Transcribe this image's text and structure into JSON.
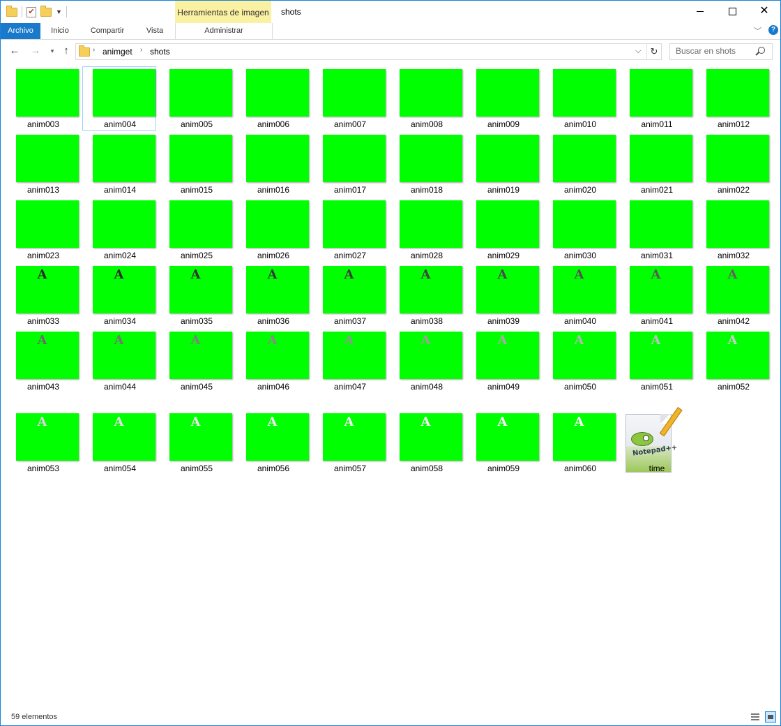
{
  "window": {
    "title": "shots",
    "context_tab_group": "Herramientas de imagen"
  },
  "ribbon": {
    "tabs": [
      "Archivo",
      "Inicio",
      "Compartir",
      "Vista"
    ],
    "context_tab": "Administrar"
  },
  "address": {
    "path": [
      "animget",
      "shots"
    ]
  },
  "search": {
    "placeholder": "Buscar en shots"
  },
  "files": [
    {
      "name": "anim003",
      "type": "image",
      "glyph": ""
    },
    {
      "name": "anim004",
      "type": "image",
      "glyph": "",
      "selected": true
    },
    {
      "name": "anim005",
      "type": "image",
      "glyph": ""
    },
    {
      "name": "anim006",
      "type": "image",
      "glyph": ""
    },
    {
      "name": "anim007",
      "type": "image",
      "glyph": ""
    },
    {
      "name": "anim008",
      "type": "image",
      "glyph": ""
    },
    {
      "name": "anim009",
      "type": "image",
      "glyph": ""
    },
    {
      "name": "anim010",
      "type": "image",
      "glyph": ""
    },
    {
      "name": "anim011",
      "type": "image",
      "glyph": ""
    },
    {
      "name": "anim012",
      "type": "image",
      "glyph": ""
    },
    {
      "name": "anim013",
      "type": "image",
      "glyph": ""
    },
    {
      "name": "anim014",
      "type": "image",
      "glyph": ""
    },
    {
      "name": "anim015",
      "type": "image",
      "glyph": ""
    },
    {
      "name": "anim016",
      "type": "image",
      "glyph": ""
    },
    {
      "name": "anim017",
      "type": "image",
      "glyph": ""
    },
    {
      "name": "anim018",
      "type": "image",
      "glyph": ""
    },
    {
      "name": "anim019",
      "type": "image",
      "glyph": ""
    },
    {
      "name": "anim020",
      "type": "image",
      "glyph": ""
    },
    {
      "name": "anim021",
      "type": "image",
      "glyph": ""
    },
    {
      "name": "anim022",
      "type": "image",
      "glyph": ""
    },
    {
      "name": "anim023",
      "type": "image",
      "glyph": ""
    },
    {
      "name": "anim024",
      "type": "image",
      "glyph": ""
    },
    {
      "name": "anim025",
      "type": "image",
      "glyph": ""
    },
    {
      "name": "anim026",
      "type": "image",
      "glyph": ""
    },
    {
      "name": "anim027",
      "type": "image",
      "glyph": ""
    },
    {
      "name": "anim028",
      "type": "image",
      "glyph": ""
    },
    {
      "name": "anim029",
      "type": "image",
      "glyph": ""
    },
    {
      "name": "anim030",
      "type": "image",
      "glyph": ""
    },
    {
      "name": "anim031",
      "type": "image",
      "glyph": ""
    },
    {
      "name": "anim032",
      "type": "image",
      "glyph": ""
    },
    {
      "name": "anim033",
      "type": "image",
      "glyph": "A",
      "glyph_color": "#2a2a2a"
    },
    {
      "name": "anim034",
      "type": "image",
      "glyph": "A",
      "glyph_color": "#2e2e2e"
    },
    {
      "name": "anim035",
      "type": "image",
      "glyph": "A",
      "glyph_color": "#333333"
    },
    {
      "name": "anim036",
      "type": "image",
      "glyph": "A",
      "glyph_color": "#383838"
    },
    {
      "name": "anim037",
      "type": "image",
      "glyph": "A",
      "glyph_color": "#3d3d3d"
    },
    {
      "name": "anim038",
      "type": "image",
      "glyph": "A",
      "glyph_color": "#424242"
    },
    {
      "name": "anim039",
      "type": "image",
      "glyph": "A",
      "glyph_color": "#4a4a4a"
    },
    {
      "name": "anim040",
      "type": "image",
      "glyph": "A",
      "glyph_color": "#525252"
    },
    {
      "name": "anim041",
      "type": "image",
      "glyph": "A",
      "glyph_color": "#5a5a5a"
    },
    {
      "name": "anim042",
      "type": "image",
      "glyph": "A",
      "glyph_color": "#626262"
    },
    {
      "name": "anim043",
      "type": "image",
      "glyph": "A",
      "glyph_color": "#6b6b6b"
    },
    {
      "name": "anim044",
      "type": "image",
      "glyph": "A",
      "glyph_color": "#757575"
    },
    {
      "name": "anim045",
      "type": "image",
      "glyph": "A",
      "glyph_color": "#7f7f7f"
    },
    {
      "name": "anim046",
      "type": "image",
      "glyph": "A",
      "glyph_color": "#898989"
    },
    {
      "name": "anim047",
      "type": "image",
      "glyph": "A",
      "glyph_color": "#949494"
    },
    {
      "name": "anim048",
      "type": "image",
      "glyph": "A",
      "glyph_color": "#9f9f9f"
    },
    {
      "name": "anim049",
      "type": "image",
      "glyph": "A",
      "glyph_color": "#aaaaaa"
    },
    {
      "name": "anim050",
      "type": "image",
      "glyph": "A",
      "glyph_color": "#b5b5b5"
    },
    {
      "name": "anim051",
      "type": "image",
      "glyph": "A",
      "glyph_color": "#c0c0c0"
    },
    {
      "name": "anim052",
      "type": "image",
      "glyph": "A",
      "glyph_color": "#cbcbcb"
    },
    {
      "name": "anim053",
      "type": "image",
      "glyph": "A",
      "glyph_color": "#d6d6d6"
    },
    {
      "name": "anim054",
      "type": "image",
      "glyph": "A",
      "glyph_color": "#dfdfdf"
    },
    {
      "name": "anim055",
      "type": "image",
      "glyph": "A",
      "glyph_color": "#e6e6e6"
    },
    {
      "name": "anim056",
      "type": "image",
      "glyph": "A",
      "glyph_color": "#ececec"
    },
    {
      "name": "anim057",
      "type": "image",
      "glyph": "A",
      "glyph_color": "#f2f2f2"
    },
    {
      "name": "anim058",
      "type": "image",
      "glyph": "A",
      "glyph_color": "#f6f6f6"
    },
    {
      "name": "anim059",
      "type": "image",
      "glyph": "A",
      "glyph_color": "#fafafa"
    },
    {
      "name": "anim060",
      "type": "image",
      "glyph": "A",
      "glyph_color": "#ffffff"
    },
    {
      "name": "time",
      "type": "text-document",
      "icon": "notepad-plus-plus-icon"
    }
  ],
  "status": {
    "item_count": "59 elementos"
  },
  "colors": {
    "accent": "#1979ca",
    "thumbnail_green": "#00ff00",
    "context_tab_yellow": "#fbf1a3",
    "selection_border": "#99d1ff"
  }
}
